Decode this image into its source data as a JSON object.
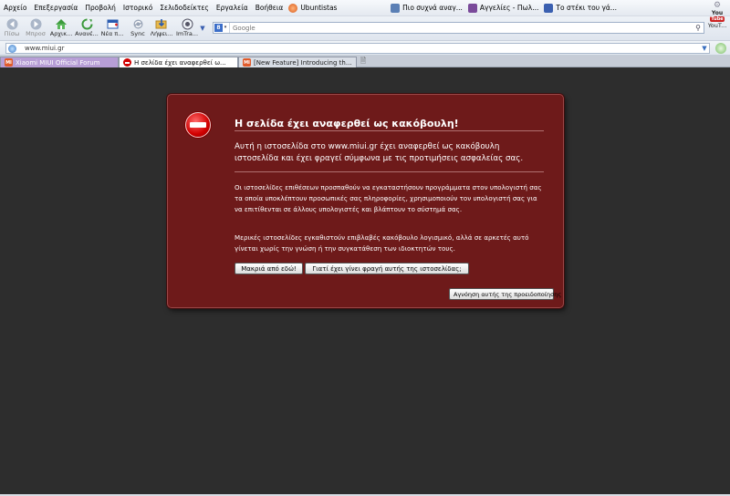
{
  "menu": [
    "Αρχείο",
    "Επεξεργασία",
    "Προβολή",
    "Ιστορικό",
    "Σελιδοδείκτες",
    "Εργαλεία",
    "Βοήθεια"
  ],
  "ubuntu_label": "Ubuntistas",
  "bookmarks": [
    {
      "label": "Πιο συχνά αναγ...",
      "color": "#5a7fb5"
    },
    {
      "label": "Αγγελίες - Πωλ...",
      "color": "#7a4a9a"
    },
    {
      "label": "Το στέκι του γά...",
      "color": "#3a5fb0"
    }
  ],
  "toolbar": {
    "back": "Πίσω",
    "forward": "Μπροσ",
    "home": "Αρχικ...",
    "reload": "Ανανέ...",
    "newtab": "Νέα π...",
    "sync": "Sync",
    "downloads": "Λήψει...",
    "imtranslator": "ImTra...",
    "search_placeholder": "Google",
    "youtube_logo": "You",
    "youtube_logo_badge": "Tube",
    "youtube": "YouT..."
  },
  "url": "www.miui.gr",
  "tabs": [
    {
      "title": "Xiaomi MIUI Official Forum",
      "fav": "MI"
    },
    {
      "title": "Η σελίδα έχει αναφερθεί ω...",
      "fav": ""
    },
    {
      "title": "[New Feature] Introducing th...",
      "fav": "MI"
    }
  ],
  "warning": {
    "title": "Η σελίδα έχει αναφερθεί ως κακόβουλη!",
    "lead": "Αυτή η ιστοσελίδα στο  www.miui.gr έχει αναφερθεί ως κακόβουλη ιστοσελίδα και έχει φραγεί σύμφωνα με τις προτιμήσεις ασφαλείας σας.",
    "p1": "Οι ιστοσελίδες επιθέσεων προσπαθούν να εγκαταστήσουν προγράμματα στον υπολογιστή σας τα οποία υποκλέπτουν προσωπικές σας πληροφορίες, χρησιμοποιούν τον υπολογιστή σας για να επιτίθενται σε άλλους υπολογιστές και βλάπτουν το σύστημά σας.",
    "p2": "Μερικές ιστοσελίδες εγκαθιστούν επιβλαβές κακόβουλο λογισμικό, αλλά σε αρκετές αυτό γίνεται χωρίς την γνώση ή την συγκατάθεση των ιδιοκτητών τους.",
    "btn_away": "Μακριά από εδώ!",
    "btn_why": "Γιατί έχει γίνει φραγή αυτής της ιστοσελίδας;",
    "btn_ignore": "Αγνόηση αυτής της προειδοποίησης"
  }
}
